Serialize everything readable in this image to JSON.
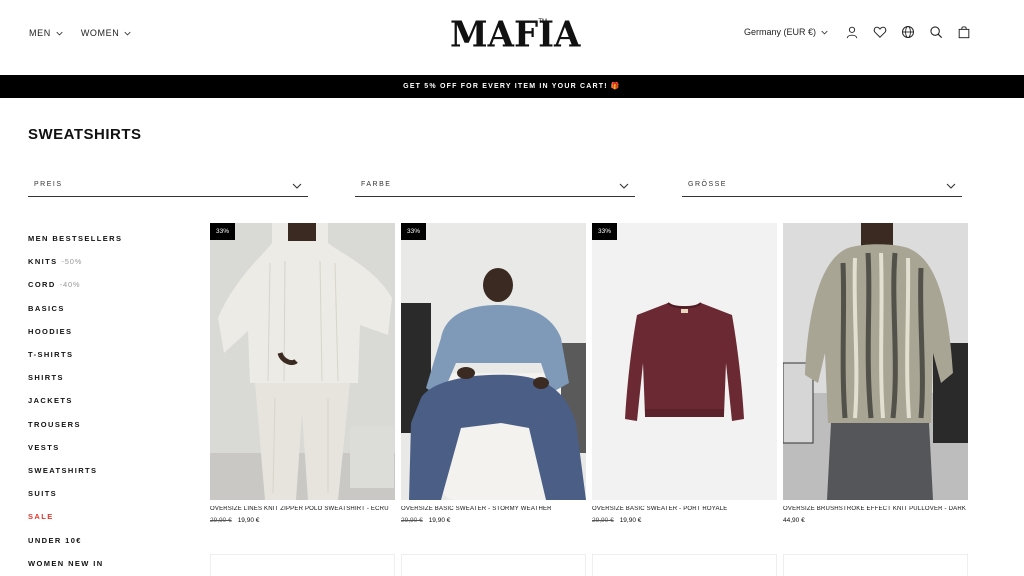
{
  "nav": {
    "left": [
      {
        "label": "MEN"
      },
      {
        "label": "WOMEN"
      }
    ],
    "logo": "MAFIA",
    "logo_tm": "TM",
    "country": "Germany (EUR €)",
    "icons": [
      "account-icon",
      "wishlist-icon",
      "globe-icon",
      "search-icon",
      "cart-icon"
    ]
  },
  "promo": "GET 5% OFF FOR EVERY ITEM IN YOUR CART! 🎁",
  "page_title": "SWEATSHIRTS",
  "filters": [
    {
      "label": "PREIS"
    },
    {
      "label": "FARBE"
    },
    {
      "label": "GRÖSSE"
    }
  ],
  "sidebar": [
    {
      "label": "MEN BESTSELLERS",
      "badge": ""
    },
    {
      "label": "KNITS",
      "badge": "-50%"
    },
    {
      "label": "CORD",
      "badge": "-40%"
    },
    {
      "label": "BASICS",
      "badge": ""
    },
    {
      "label": "HOODIES",
      "badge": ""
    },
    {
      "label": "T-SHIRTS",
      "badge": ""
    },
    {
      "label": "SHIRTS",
      "badge": ""
    },
    {
      "label": "JACKETS",
      "badge": ""
    },
    {
      "label": "TROUSERS",
      "badge": ""
    },
    {
      "label": "VESTS",
      "badge": ""
    },
    {
      "label": "SWEATSHIRTS",
      "badge": ""
    },
    {
      "label": "SUITS",
      "badge": ""
    },
    {
      "label": "SALE",
      "badge": ""
    },
    {
      "label": "UNDER 10€",
      "badge": ""
    },
    {
      "label": "WOMEN NEW IN",
      "badge": ""
    }
  ],
  "products": [
    {
      "discount": "33%",
      "name": "OVERSIZE LINES KNIT ZIPPER POLO SWEATSHIRT - ECRU",
      "old_price": "29,90 €",
      "price": "19,90 €",
      "color": "#e8e4da"
    },
    {
      "discount": "33%",
      "name": "OVERSIZE BASIC SWEATER - STORMY WEATHER",
      "old_price": "29,90 €",
      "price": "19,90 €",
      "color": "#7f9ab8"
    },
    {
      "discount": "33%",
      "name": "OVERSIZE BASIC SWEATER - PORT ROYALE",
      "old_price": "29,90 €",
      "price": "19,90 €",
      "color": "#6b2a33"
    },
    {
      "discount": "",
      "name": "OVERSIZE BRUSHSTROKE EFFECT KNIT PULLOVER - DARK GREY",
      "old_price": "",
      "price": "44,90 €",
      "color": "#8a887c"
    }
  ],
  "colors": {
    "sale": "#e0362b",
    "promo_bg": "#000000"
  }
}
